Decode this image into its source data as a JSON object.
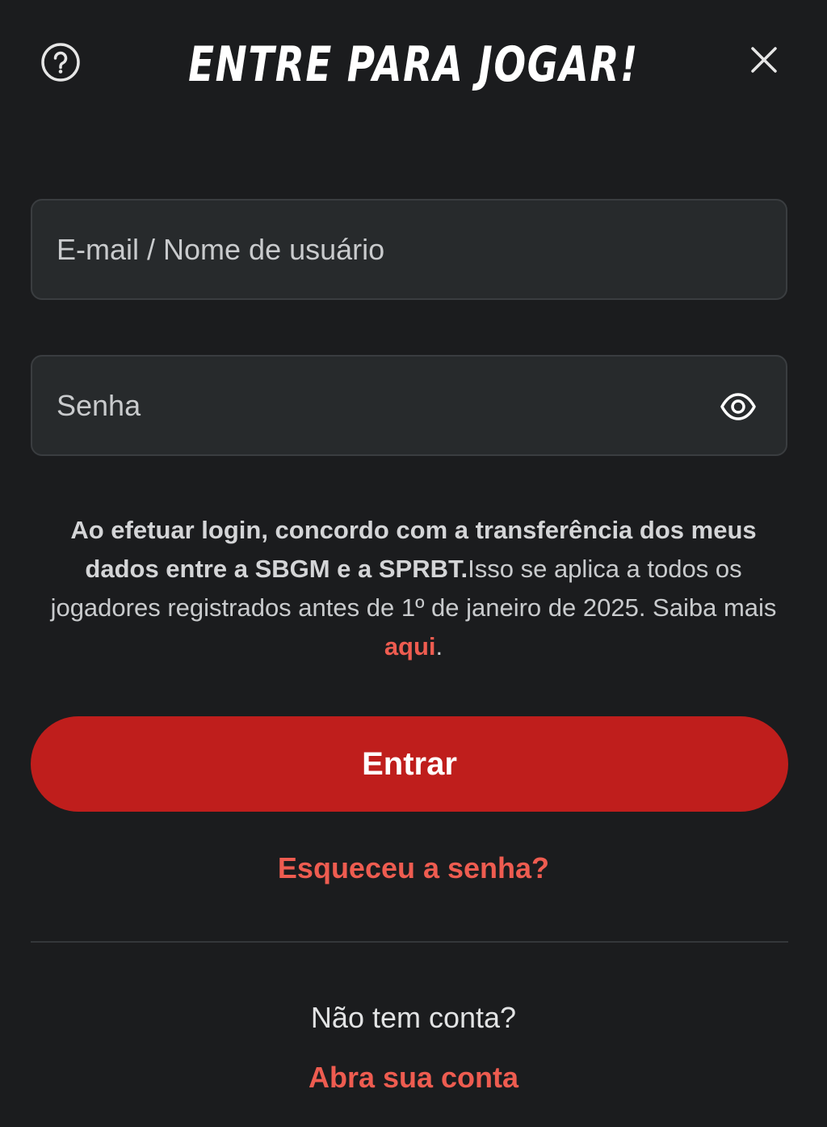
{
  "header": {
    "title": "ENTRE PARA JOGAR!",
    "help_icon": "question-circle-icon",
    "close_icon": "close-icon"
  },
  "form": {
    "username_placeholder": "E-mail / Nome de usuário",
    "username_value": "",
    "password_placeholder": "Senha",
    "password_value": "",
    "password_toggle_icon": "eye-icon"
  },
  "disclaimer": {
    "bold_text": "Ao efetuar login, concordo com a transferência dos meus dados entre a SBGM e a SPRBT.",
    "regular_text": "Isso se aplica a todos os jogadores registrados antes de 1º de janeiro de 2025. Saiba mais ",
    "link_text": "aqui",
    "trailing": "."
  },
  "actions": {
    "submit_label": "Entrar",
    "forgot_password": "Esqueceu a senha?",
    "no_account": "Não tem conta?",
    "signup_link": "Abra sua conta"
  },
  "colors": {
    "background": "#1b1c1e",
    "field_background": "#272a2c",
    "accent": "#bf1e1c",
    "link": "#ee5c50"
  }
}
